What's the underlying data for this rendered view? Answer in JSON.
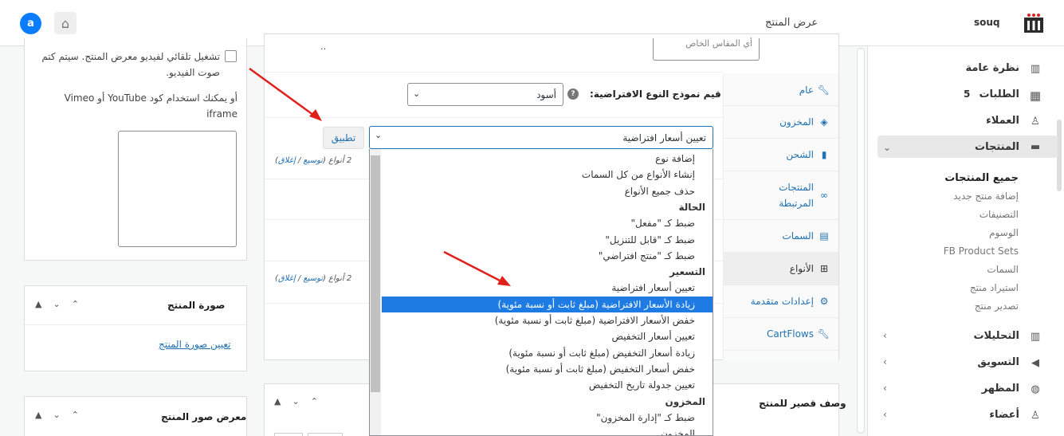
{
  "header": {
    "brand": "souq",
    "page_title": "عرض المنتج",
    "avatar_letter": "a"
  },
  "sidebar": {
    "items": [
      {
        "label": "نظرة عامة",
        "icon": "chart-icon"
      },
      {
        "label": "الطلبات",
        "badge": "5",
        "icon": "grid-icon"
      },
      {
        "label": "العملاء",
        "icon": "users-icon"
      },
      {
        "label": "المنتجات",
        "icon": "box-icon"
      },
      {
        "label": "التحليلات",
        "icon": "chart-icon"
      },
      {
        "label": "التسويق",
        "icon": "megaphone-icon"
      },
      {
        "label": "المظهر",
        "icon": "palette-icon"
      },
      {
        "label": "أعضاء",
        "icon": "users-icon"
      }
    ],
    "products_sub": [
      "جميع المنتجات",
      "إضافة منتج جديد",
      "التصنيفات",
      "الوسوم",
      "FB Product Sets",
      "السمات",
      "استيراد منتج",
      "تصدير منتج"
    ]
  },
  "product_data": {
    "tabs": [
      "عام",
      "المخزون",
      "الشحن",
      "المنتجات المرتبطة",
      "السمات",
      "الأنواع",
      "إعدادات متقدمة",
      "CartFlows"
    ],
    "default_form_label": "قيم نموذج النوع الافتراضية:",
    "default_color": "أسود",
    "bulk_select_value": "تعيين أسعار افتراضية",
    "apply_button": "تطبيق",
    "variations_count": "2 أنواع",
    "expand_link": "توسيع",
    "collapse_link": "إغلاق",
    "sep": "/",
    "top_cut_select": "أي المقاس الخاص"
  },
  "dropdown_options": [
    {
      "text": "إضافة نوع",
      "group": false
    },
    {
      "text": "إنشاء الأنواع من كل السمات",
      "group": false
    },
    {
      "text": "حذف جميع الأنواع",
      "group": false
    },
    {
      "text": "الحالة",
      "group": true
    },
    {
      "text": "ضبط كـ \"مفعل\"",
      "group": false
    },
    {
      "text": "ضبط كـ \"قابل للتنزيل\"",
      "group": false
    },
    {
      "text": "ضبط كـ \"منتج افتراضي\"",
      "group": false
    },
    {
      "text": "التسعير",
      "group": true
    },
    {
      "text": "تعيين أسعار افتراضية",
      "group": false
    },
    {
      "text": "زيادة الأسعار الافتراضية (مبلغ ثابت أو نسبة مئوية)",
      "group": false,
      "selected": true
    },
    {
      "text": "خفض الأسعار الافتراضية (مبلغ ثابت أو نسبة مئوية)",
      "group": false
    },
    {
      "text": "تعيين أسعار التخفيض",
      "group": false
    },
    {
      "text": "زيادة أسعار التخفيض (مبلغ ثابت أو نسبة مئوية)",
      "group": false
    },
    {
      "text": "خفض أسعار التخفيض (مبلغ ثابت أو نسبة مئوية)",
      "group": false
    },
    {
      "text": "تعيين جدولة تاريخ التخفيض",
      "group": false
    },
    {
      "text": "المخزون",
      "group": true
    },
    {
      "text": "ضبط كـ \"إدارة المخزون\"",
      "group": false
    },
    {
      "text": "المخزون",
      "group": false
    }
  ],
  "left_col": {
    "video_autoplay_text": "تشغيل تلقائي لفيديو معرض المنتج. سيتم كتم صوت الفيديو.",
    "embed_hint": "أو يمكنك استخدام كود YouTube أو Vimeo iframe",
    "product_image_title": "صورة المنتج",
    "set_image_link": "تعيين صورة المنتج",
    "gallery_title": "معرض صور المنتج",
    "short_desc_title": "وصف قصير للمنتج"
  },
  "colors": {
    "accent": "#2271b1",
    "selected_option": "#1e7be4",
    "arrow": "#e0201b"
  }
}
